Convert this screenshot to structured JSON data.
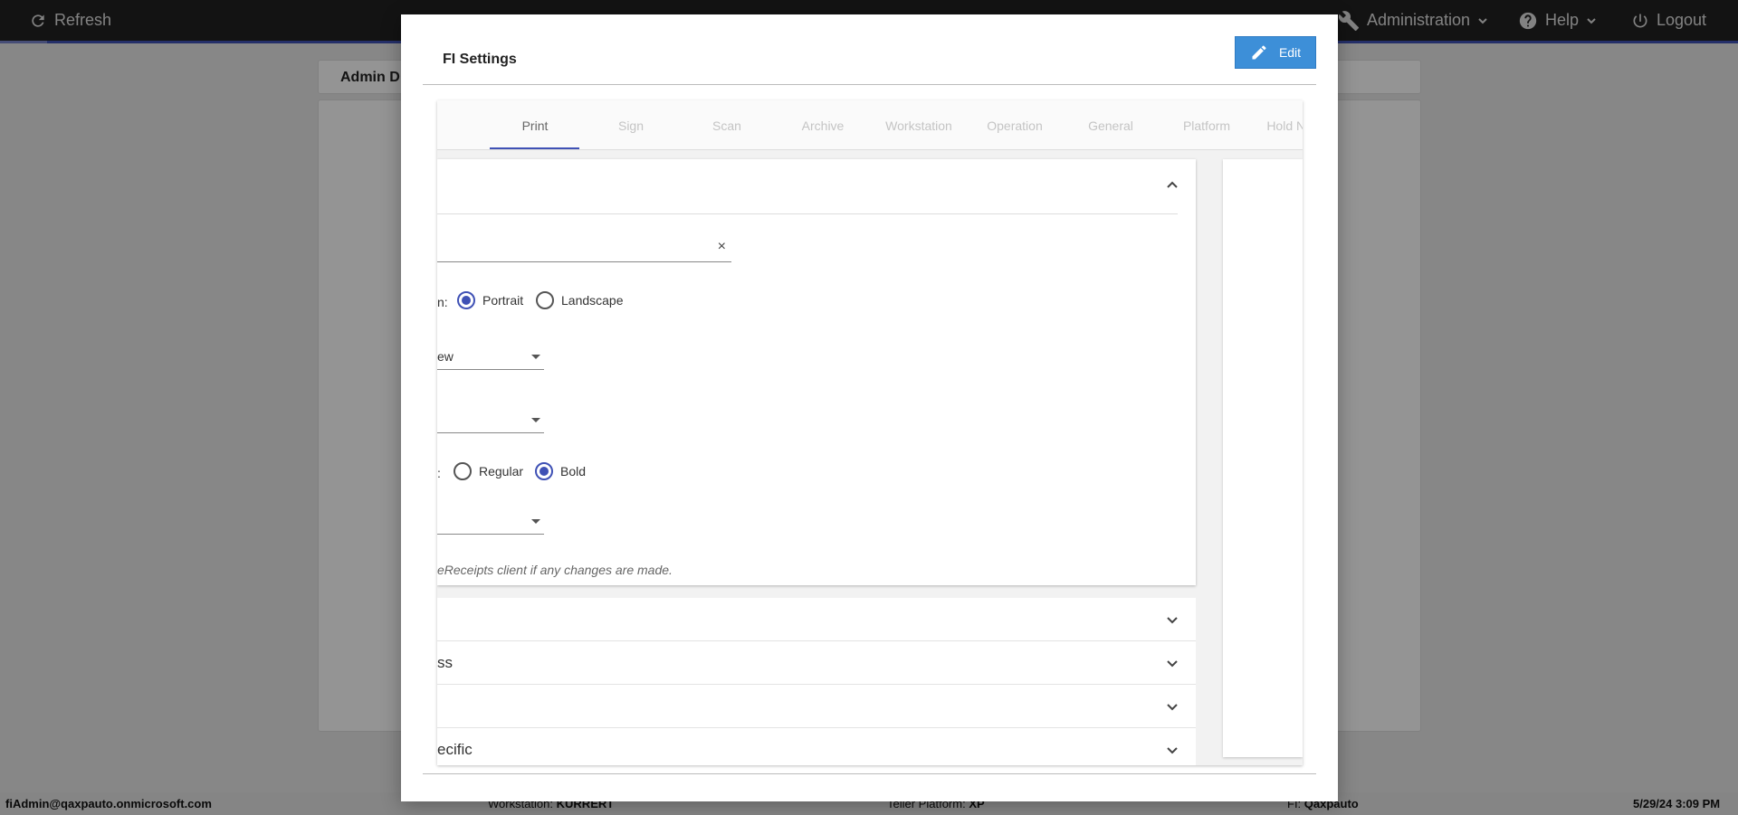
{
  "topbar": {
    "refresh_label": "Refresh",
    "administration_label": "Administration",
    "help_label": "Help",
    "logout_label": "Logout"
  },
  "background": {
    "card_title": "Admin D"
  },
  "footer": {
    "user": "fiAdmin@qaxpauto.onmicrosoft.com",
    "workstation_label": "Workstation:",
    "workstation_value": "KURRERT",
    "teller_label": "Teller Platform:",
    "teller_value": "XP",
    "fi_label": "FI:",
    "fi_value": "Qaxpauto",
    "datetime": "5/29/24 3:09 PM"
  },
  "modal": {
    "title": "FI Settings",
    "edit_label": "Edit",
    "tabs": [
      {
        "label": "Print",
        "active": true
      },
      {
        "label": "Sign",
        "active": false
      },
      {
        "label": "Scan",
        "active": false
      },
      {
        "label": "Archive",
        "active": false
      },
      {
        "label": "Workstation",
        "active": false
      },
      {
        "label": "Operation",
        "active": false
      },
      {
        "label": "General",
        "active": false
      },
      {
        "label": "Platform",
        "active": false
      },
      {
        "label": "Hold Notices",
        "active": false
      }
    ],
    "print": {
      "clear_symbol": "×",
      "orientation_label": "n:",
      "orientation_options": [
        "Portrait",
        "Landscape"
      ],
      "orientation_selected": "Portrait",
      "select1_value": "ew",
      "select2_value": "",
      "weight_label": ":",
      "weight_options": [
        "Regular",
        "Bold"
      ],
      "weight_selected": "Bold",
      "select3_value": "",
      "note": "eReceipts client if any changes are made."
    },
    "sections": [
      {
        "label": ""
      },
      {
        "label": "ss"
      },
      {
        "label": ""
      },
      {
        "label": "ecific"
      }
    ]
  },
  "colors": {
    "accent": "#3f51b5",
    "edit_button": "#3d8fd8",
    "topbar": "#222222"
  }
}
